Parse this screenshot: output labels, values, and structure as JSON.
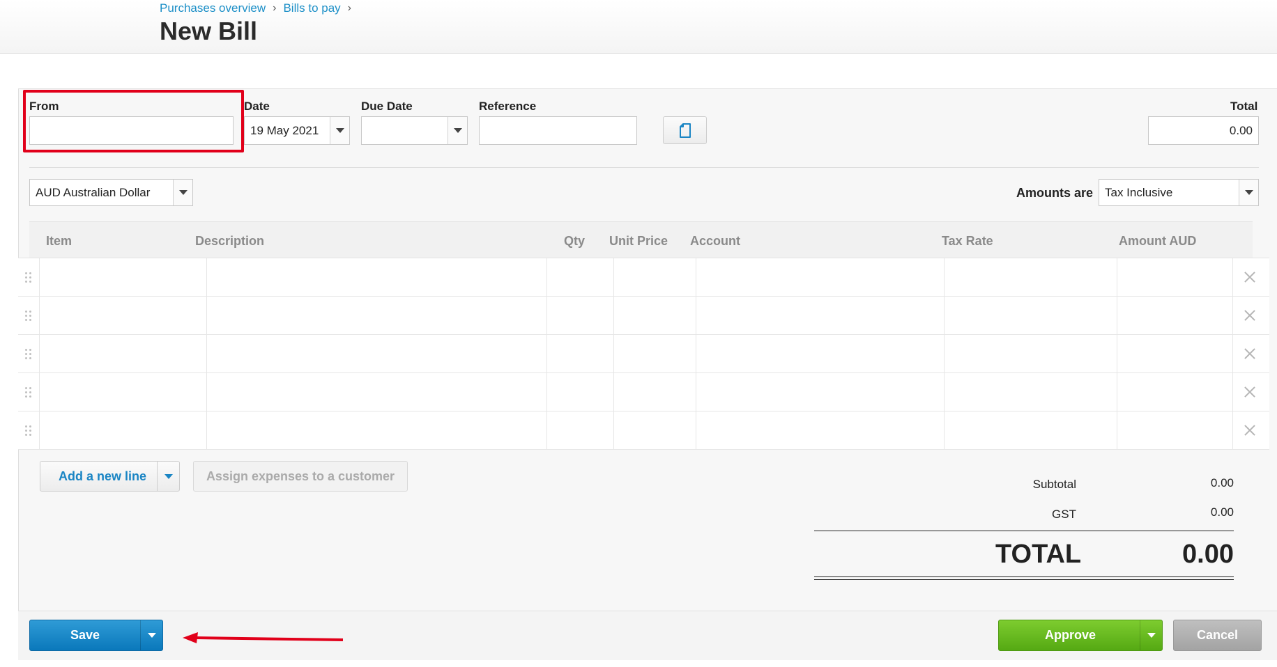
{
  "breadcrumb": {
    "items": [
      "Purchases overview",
      "Bills to pay"
    ],
    "separator": "›"
  },
  "page": {
    "title": "New Bill"
  },
  "form": {
    "from": {
      "label": "From",
      "value": ""
    },
    "date": {
      "label": "Date",
      "value": "19 May 2021"
    },
    "due_date": {
      "label": "Due Date",
      "value": ""
    },
    "reference": {
      "label": "Reference",
      "value": ""
    },
    "total": {
      "label": "Total",
      "value": "0.00"
    },
    "attach_icon": "document-icon"
  },
  "currency": {
    "selected": "AUD Australian Dollar"
  },
  "amounts_are": {
    "label": "Amounts are",
    "selected": "Tax Inclusive"
  },
  "table": {
    "columns": [
      "Item",
      "Description",
      "Qty",
      "Unit Price",
      "Account",
      "Tax Rate",
      "Amount AUD"
    ],
    "row_count": 5
  },
  "actions": {
    "add_line": "Add a new line",
    "assign_expenses": "Assign expenses to a customer",
    "save": "Save",
    "approve": "Approve",
    "cancel": "Cancel"
  },
  "totals": {
    "subtotal_label": "Subtotal",
    "subtotal_value": "0.00",
    "gst_label": "GST",
    "gst_value": "0.00",
    "total_label": "TOTAL",
    "total_value": "0.00"
  },
  "colors": {
    "link": "#1c8fc7",
    "save": "#0a78bb",
    "approve": "#55a913",
    "cancel": "#a3a3a3",
    "annotation": "#e1001a"
  }
}
